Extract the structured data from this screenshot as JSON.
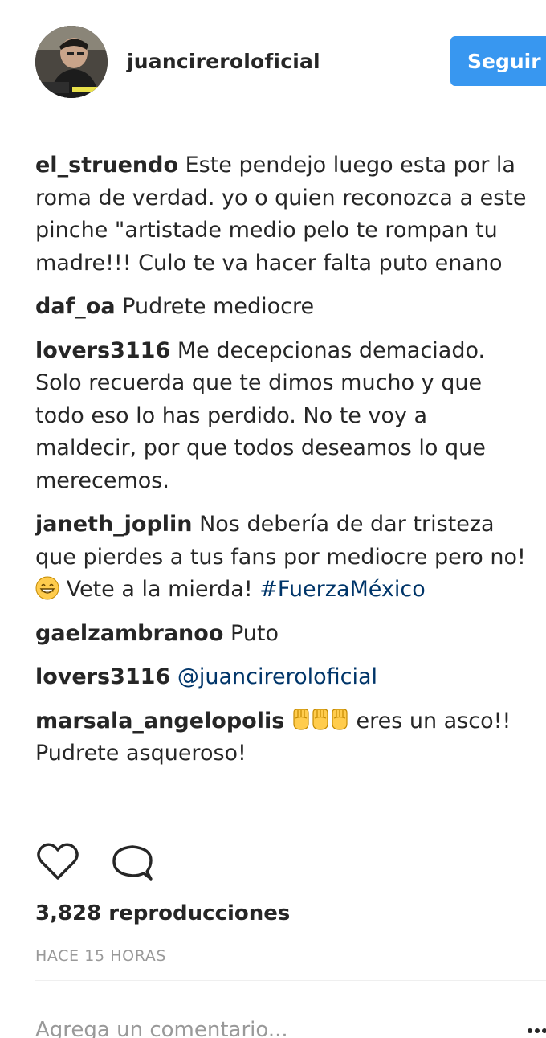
{
  "header": {
    "username": "juancireroloficial",
    "follow_label": "Seguir"
  },
  "comments": [
    {
      "author": "el_struendo",
      "text": "Este pendejo luego esta por la roma de verdad. yo o quien reconozca a este pinche \"artistade medio pelo te rompan tu madre!!! Culo te va hacer falta puto enano"
    },
    {
      "author": "daf_oa",
      "text": "Pudrete mediocre"
    },
    {
      "author": "lovers3116",
      "text": "Me decepcionas demaciado. Solo recuerda que te dimos mucho y que todo eso lo has perdido. No te voy a maldecir, por que todos deseamos lo que merecemos."
    },
    {
      "author": "janeth_joplin",
      "text_before": "Nos debería de dar tristeza que pierdes a tus fans por mediocre pero no!",
      "text_after": "Vete a la mierda!",
      "hashtag": "#FuerzaMéxico",
      "emoji_icon": "grinning-face-icon"
    },
    {
      "author": "gaelzambranoo",
      "text": "Puto"
    },
    {
      "author": "lovers3116",
      "mention": "@juancireroloficial"
    },
    {
      "author": "marsala_angelopolis",
      "emoji_icon": "raised-fist-icon",
      "emoji_count": 3,
      "text": "eres un asco!! Pudrete asqueroso!"
    }
  ],
  "actions": {
    "like_icon": "heart-icon",
    "comment_icon": "speech-bubble-icon"
  },
  "stats": {
    "views": "3,828 reproducciones",
    "time": "HACE 15 HORAS"
  },
  "add_comment": {
    "placeholder": "Agrega un comentario...",
    "more_icon": "ellipsis-icon"
  },
  "colors": {
    "follow_button": "#3897f0",
    "link": "#003569",
    "muted": "#999999",
    "text": "#262626",
    "emoji_yellow": "#ffcc4d"
  }
}
